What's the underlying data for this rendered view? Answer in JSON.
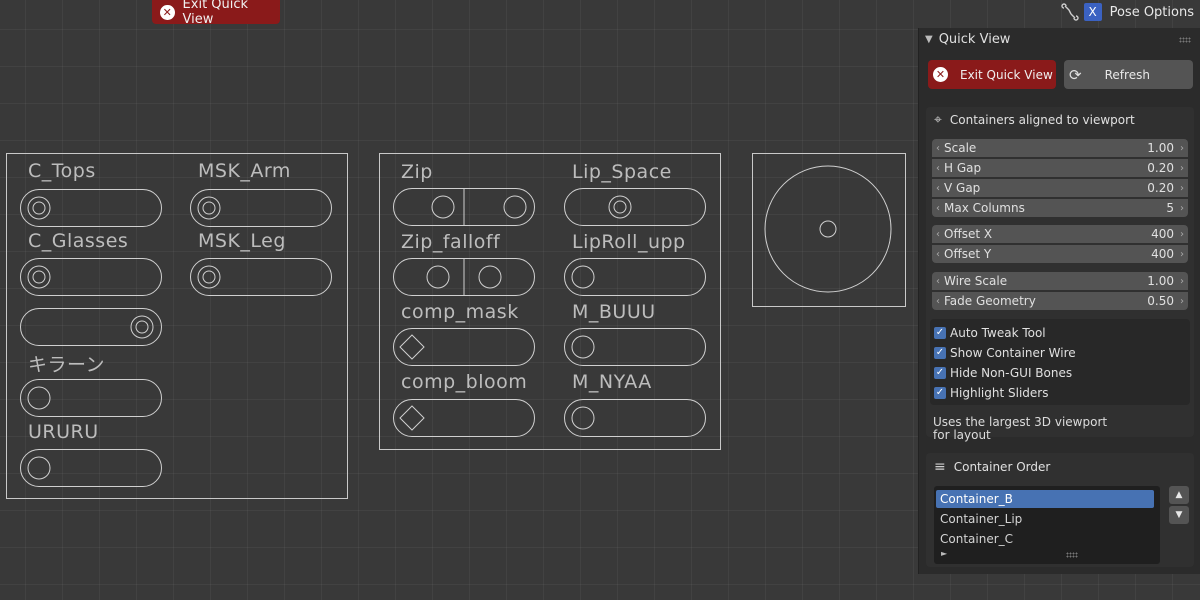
{
  "toolbar": {
    "exit_quick_view": "Exit Quick View",
    "axis_label": "X",
    "pose_options": "Pose Options"
  },
  "viewport": {
    "container_a": {
      "labels": [
        "C_Tops",
        "MSK_Arm",
        "C_Glasses",
        "MSK_Leg",
        "キラーン",
        "URURU"
      ]
    },
    "container_b": {
      "labels": [
        "Zip",
        "Lip_Space",
        "Zip_falloff",
        "LipRoll_upp",
        "comp_mask",
        "M_BUUU",
        "comp_bloom",
        "M_NYAA"
      ]
    }
  },
  "panel": {
    "title": "Quick View",
    "exit_button": "Exit Quick View",
    "refresh_button": "Refresh",
    "containers_section": "Containers aligned to viewport",
    "fields": {
      "scale": {
        "name": "Scale",
        "value": "1.00"
      },
      "h_gap": {
        "name": "H Gap",
        "value": "0.20"
      },
      "v_gap": {
        "name": "V Gap",
        "value": "0.20"
      },
      "max_columns": {
        "name": "Max Columns",
        "value": "5"
      },
      "offset_x": {
        "name": "Offset X",
        "value": "400"
      },
      "offset_y": {
        "name": "Offset Y",
        "value": "400"
      },
      "wire_scale": {
        "name": "Wire Scale",
        "value": "1.00"
      },
      "fade_geometry": {
        "name": "Fade Geometry",
        "value": "0.50"
      }
    },
    "checkboxes": [
      {
        "label": "Auto Tweak Tool",
        "checked": true
      },
      {
        "label": "Show Container Wire",
        "checked": true
      },
      {
        "label": "Hide Non-GUI Bones",
        "checked": true
      },
      {
        "label": "Highlight Sliders",
        "checked": true
      }
    ],
    "note_line1": "Uses the largest 3D viewport",
    "note_line2": "for layout",
    "order_section": "Container Order",
    "order_items": [
      "Container_B",
      "Container_Lip",
      "Container_C"
    ],
    "selected_item": "Container_B"
  },
  "colors": {
    "viewport_bg": "#393939",
    "panel_bg": "#2b2b2b",
    "exit_red": "#8a1a1a",
    "accent_blue": "#4772b3",
    "wire": "#d0d0d0"
  },
  "icons": [
    "close-circle-icon",
    "bone-icon",
    "refresh-icon",
    "align-icon",
    "sort-icon",
    "chevron-down-icon",
    "checkmark-icon",
    "arrow-up-icon",
    "arrow-down-icon"
  ]
}
